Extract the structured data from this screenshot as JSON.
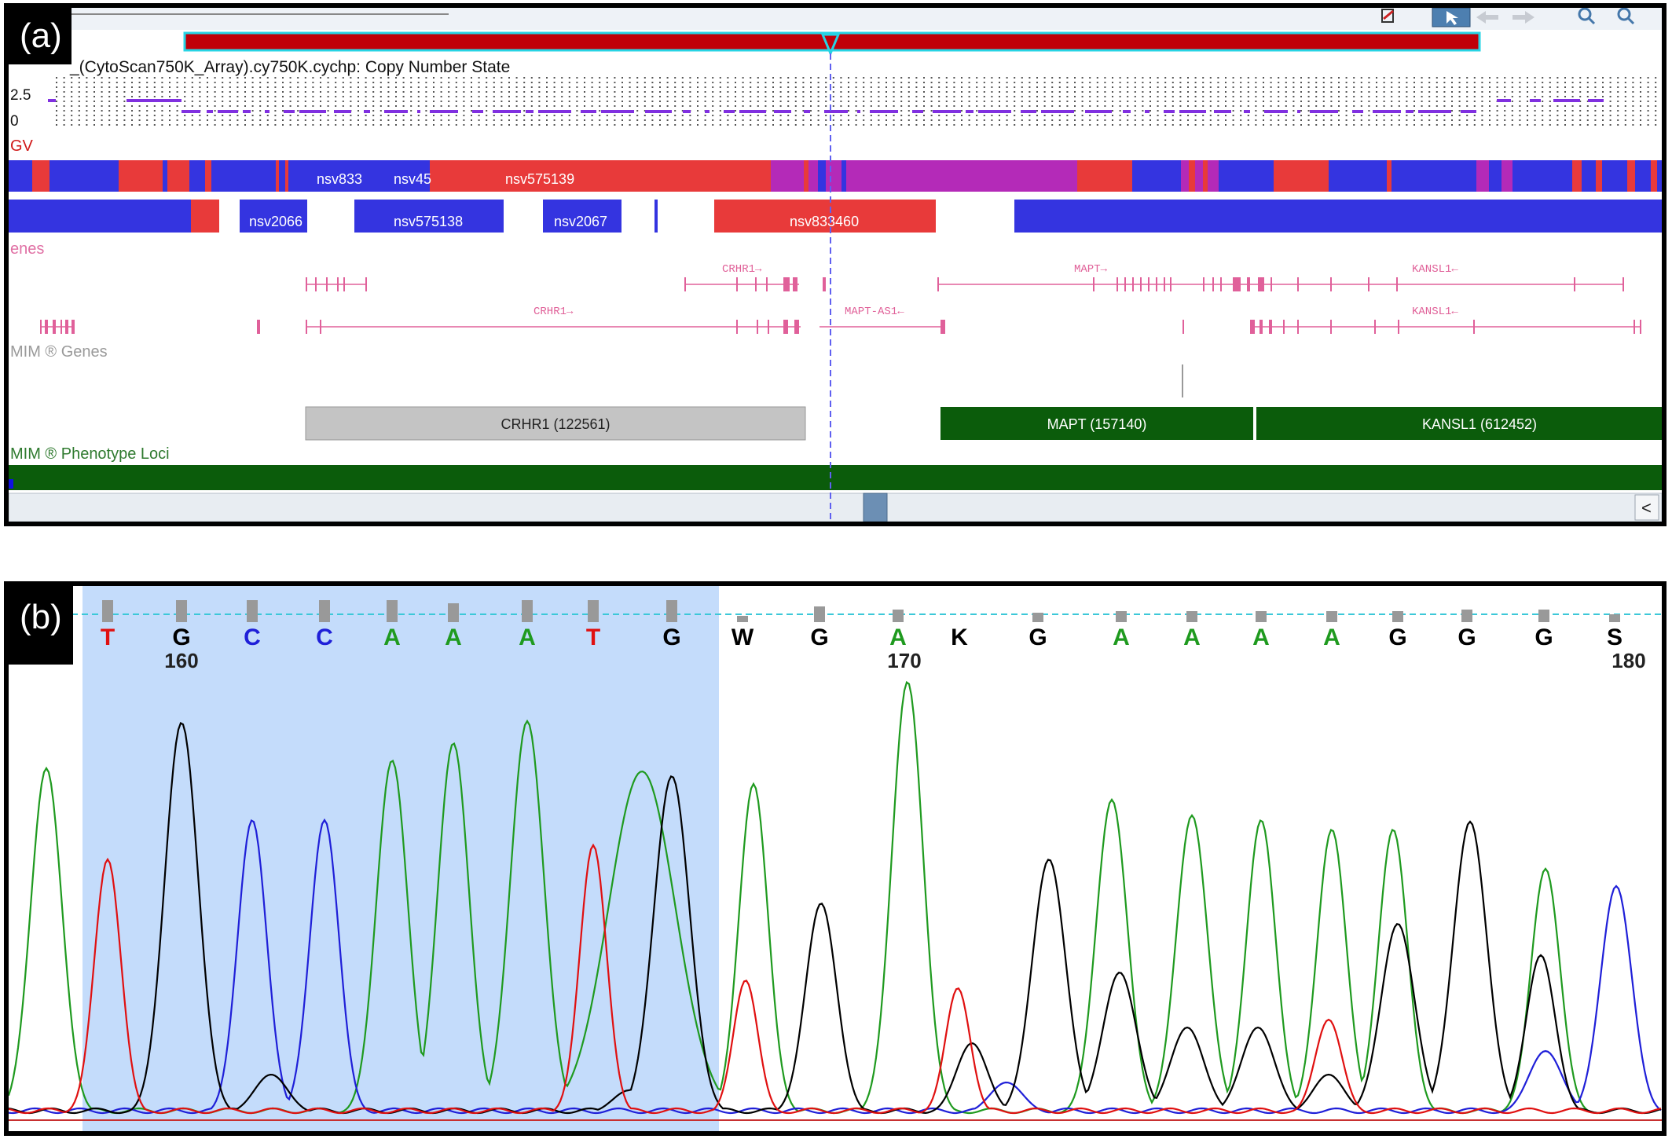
{
  "panel_a": {
    "tag": "(a)",
    "track_title": "_(CytoScan750K_Array).cy750K.cychp: Copy Number State",
    "cn_labels": [
      "2.5",
      "0"
    ],
    "dgv_label": "GV",
    "dgv_row1_labels": [
      "nsv833",
      "nsv45",
      "nsv575139"
    ],
    "dgv_row2_labels": [
      "nsv2066",
      "nsv575138",
      "nsv2067",
      "nsv833460"
    ],
    "genes_label": "enes",
    "gene_labels": [
      "CRHR1→",
      "MAPT→",
      "KANSL1←",
      "CRHR1→",
      "MAPT-AS1←",
      "KANSL1←"
    ],
    "mim_genes_label": "MIM ® Genes",
    "mim_boxes": [
      "CRHR1 (122561)",
      "MAPT (157140)",
      "KANSL1 (612452)"
    ],
    "phenotype_label": "MIM ® Phenotype Loci",
    "scroll_left_arrow": "<",
    "colors": {
      "red": "#e83a3a",
      "blue": "#3434e0",
      "purple": "#b42ab8",
      "green": "#0b5c0b",
      "gene_pink": "#e0609a",
      "dark_red": "#c00000"
    }
  },
  "panel_b": {
    "tag": "(b)",
    "bases": [
      "T",
      "G",
      "C",
      "C",
      "A",
      "A",
      "A",
      "T",
      "G",
      "W",
      "G",
      "A",
      "K",
      "G",
      "A",
      "A",
      "A",
      "A",
      "G",
      "G",
      "G",
      "S"
    ],
    "position_labels": [
      "160",
      "170",
      "180"
    ],
    "colors": {
      "A": "#1f9a1f",
      "C": "#1f1fd8",
      "G": "#000000",
      "T": "#e01010",
      "highlight": "#c4dcfb",
      "baseline": "#3cc8d8"
    }
  }
}
